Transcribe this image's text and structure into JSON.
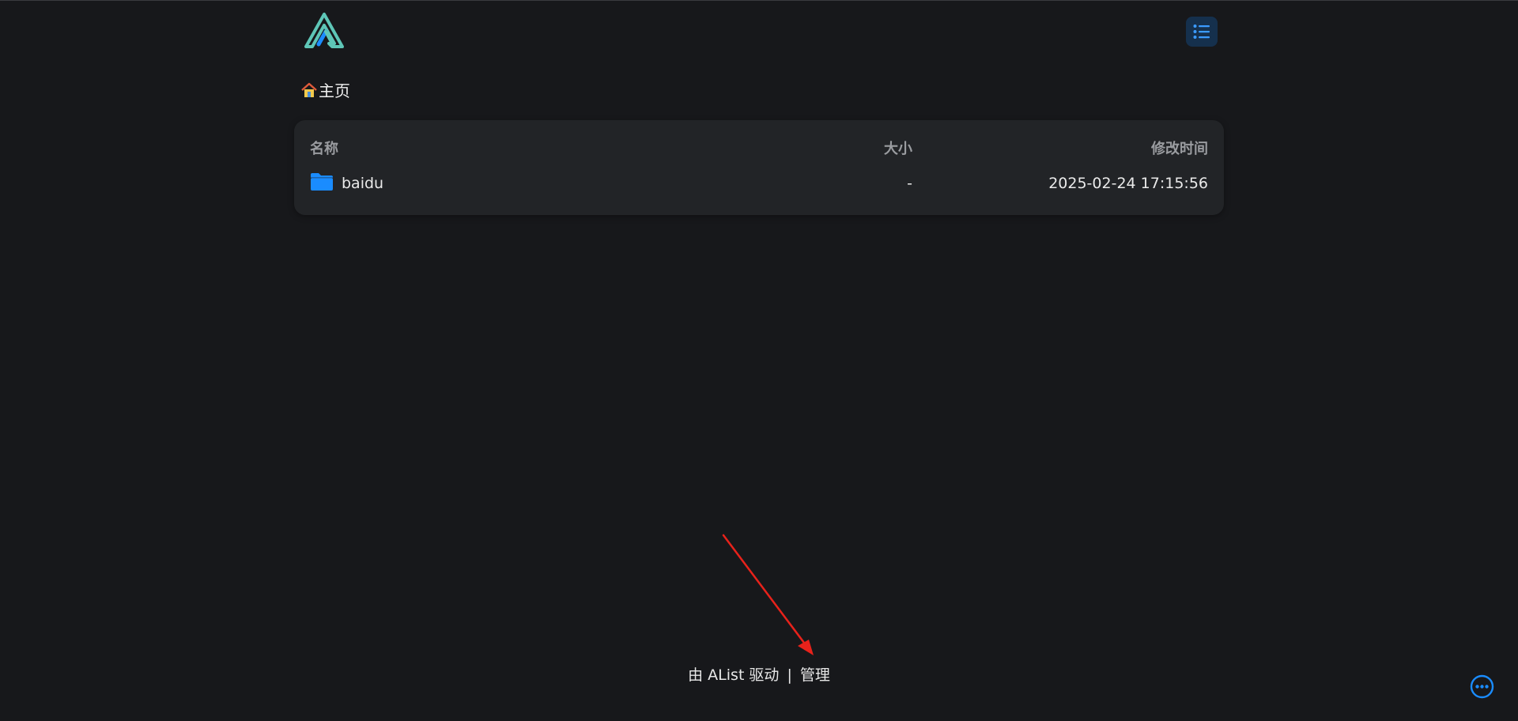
{
  "header": {
    "logo_icon": "alist-logo",
    "menu_icon": "list-icon"
  },
  "breadcrumb": {
    "home_icon": "house-icon",
    "label": "主页"
  },
  "table": {
    "columns": {
      "name": "名称",
      "size": "大小",
      "modified": "修改时间"
    },
    "rows": [
      {
        "icon": "folder-icon",
        "name": "baidu",
        "size": "-",
        "modified": "2025-02-24 17:15:56"
      }
    ]
  },
  "footer": {
    "powered_by": "由 AList 驱动",
    "separator": "|",
    "manage": "管理"
  },
  "floating": {
    "more_icon": "more-dots-icon"
  },
  "colors": {
    "background": "#17181b",
    "panel": "#222427",
    "accent": "#1a8cff",
    "logo_teal": "#5ec6b7",
    "annotation_arrow": "#e8221b"
  }
}
